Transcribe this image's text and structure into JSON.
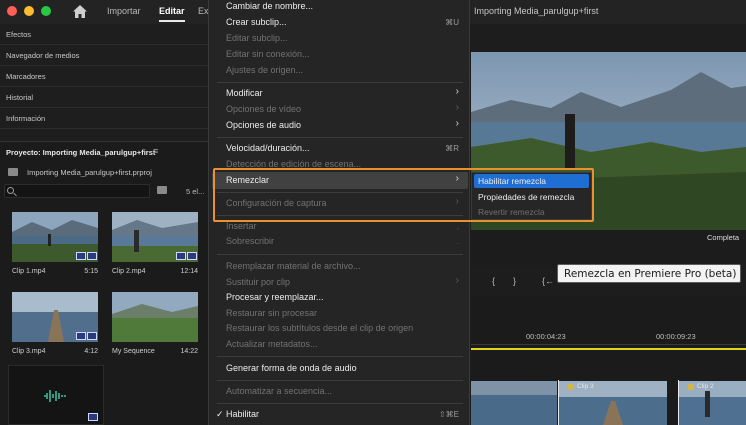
{
  "header": {
    "nav_tabs": [
      "Importar",
      "Editar",
      "Ex"
    ],
    "active_tab": "Editar",
    "project_title": "Importing Media_parulgup+first"
  },
  "left_panels": {
    "items": [
      "Efectos",
      "Navegador de medios",
      "Marcadores",
      "Historial",
      "Información"
    ],
    "project_panel": {
      "title": "Proyecto: Importing Media_parulgup+first",
      "menu_glyph": "≡",
      "file": "Importing Media_parulgup+first.prproj",
      "count": "5 el..."
    },
    "clips": [
      {
        "name": "Clip 1.mp4",
        "duration": "5:15"
      },
      {
        "name": "Clip 2.mp4",
        "duration": "12:14"
      },
      {
        "name": "Clip 3.mp4",
        "duration": "4:12"
      },
      {
        "name": "My Sequence",
        "duration": "14:22"
      }
    ]
  },
  "menu": {
    "items": [
      {
        "label": "Cambiar de nombre...",
        "shortcut": "",
        "disabled": false,
        "submenu": false
      },
      {
        "label": "Crear subclip...",
        "shortcut": "⌘U",
        "disabled": false,
        "submenu": false
      },
      {
        "label": "Editar subclip...",
        "shortcut": "",
        "disabled": true,
        "submenu": false
      },
      {
        "label": "Editar sin conexión...",
        "shortcut": "",
        "disabled": true,
        "submenu": false
      },
      {
        "label": "Ajustes de origen...",
        "shortcut": "",
        "disabled": true,
        "submenu": false
      },
      {
        "label": "Modificar",
        "shortcut": "",
        "disabled": false,
        "submenu": true
      },
      {
        "label": "Opciones de vídeo",
        "shortcut": "",
        "disabled": true,
        "submenu": true
      },
      {
        "label": "Opciones de audio",
        "shortcut": "",
        "disabled": false,
        "submenu": true
      },
      {
        "label": "Velocidad/duración...",
        "shortcut": "⌘R",
        "disabled": false,
        "submenu": false
      },
      {
        "label": "Detección de edición de escena...",
        "shortcut": "",
        "disabled": true,
        "submenu": false
      },
      {
        "label": "Remezclar",
        "shortcut": "",
        "disabled": false,
        "submenu": true
      },
      {
        "label": "Configuración de captura",
        "shortcut": "",
        "disabled": true,
        "submenu": true
      },
      {
        "label": "Insertar",
        "shortcut": ",",
        "disabled": true,
        "submenu": false
      },
      {
        "label": "Sobrescribir",
        "shortcut": ".",
        "disabled": true,
        "submenu": false
      },
      {
        "label": "Reemplazar material de archivo...",
        "shortcut": "",
        "disabled": true,
        "submenu": false
      },
      {
        "label": "Sustituir por clip",
        "shortcut": "",
        "disabled": true,
        "submenu": true
      },
      {
        "label": "Procesar y reemplazar...",
        "shortcut": "",
        "disabled": false,
        "submenu": false
      },
      {
        "label": "Restaurar sin procesar",
        "shortcut": "",
        "disabled": true,
        "submenu": false
      },
      {
        "label": "Restaurar los subtítulos desde el clip de origen",
        "shortcut": "",
        "disabled": true,
        "submenu": false
      },
      {
        "label": "Actualizar metadatos...",
        "shortcut": "",
        "disabled": true,
        "submenu": false
      },
      {
        "label": "Generar forma de onda de audio",
        "shortcut": "",
        "disabled": false,
        "submenu": false
      },
      {
        "label": "Automatizar a secuencia...",
        "shortcut": "",
        "disabled": true,
        "submenu": false
      },
      {
        "label": "Habilitar",
        "shortcut": "⇧⌘E",
        "disabled": false,
        "submenu": false,
        "checked": true
      }
    ],
    "check_glyph": "✓",
    "arrow_glyph": "›"
  },
  "submenu": {
    "items": [
      {
        "label": "Habilitar remezcla",
        "disabled": false,
        "highlighted": true
      },
      {
        "label": "Propiedades de remezcla",
        "disabled": false,
        "highlighted": false
      },
      {
        "label": "Revertir remezcla",
        "disabled": true,
        "highlighted": false
      }
    ]
  },
  "program": {
    "zoom": "Completa",
    "tooltip": "Remezcla en Premiere Pro (beta)"
  },
  "timeline": {
    "timecodes": [
      "00:00:04:23",
      "00:00:09:23"
    ],
    "clips": [
      "Clip 3",
      "Clip 2"
    ]
  },
  "colors": {
    "highlight": "#1f6ed4",
    "callout": "#e8912d",
    "audio_badge": "#2a3a7a",
    "timeline_bar": "#e2d51c"
  },
  "icons": [
    "home-icon",
    "search-icon",
    "folder-icon",
    "bin-icon",
    "audio-waveform-icon",
    "checkmark-icon",
    "submenu-arrow-icon",
    "fx-icon"
  ]
}
